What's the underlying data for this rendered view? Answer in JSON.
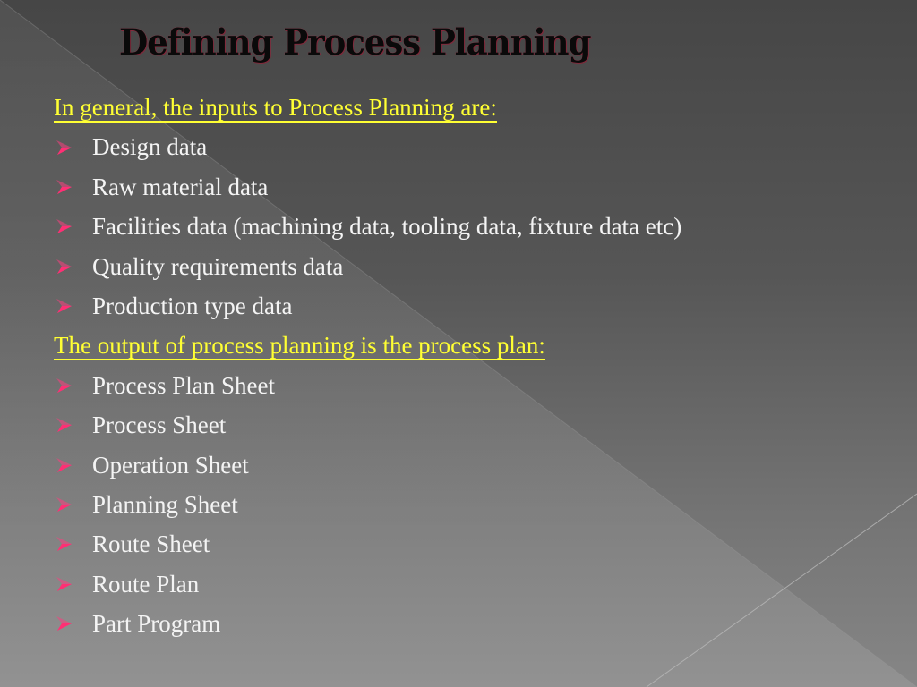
{
  "slide": {
    "title": "Defining Process Planning",
    "colors": {
      "title_text": "#0a0a0a",
      "title_outline": "#b0304a",
      "heading_text": "#ffff33",
      "bullet_text": "#f4f4f4",
      "bullet_icon": "#ff3d7f",
      "background_top": "#464646",
      "background_bottom": "#868686"
    },
    "inputs_section": {
      "heading": "In general, the inputs to Process Planning are:",
      "bullet_icon": "arrowhead-bullet-icon",
      "items": [
        "Design data",
        "Raw material data",
        "Facilities data (machining data, tooling data, fixture data etc)",
        "Quality requirements data",
        "Production type data"
      ]
    },
    "outputs_section": {
      "heading": "The output of process planning is the process plan:",
      "bullet_icon": "arrowhead-bullet-icon",
      "items": [
        "Process Plan Sheet",
        "Process Sheet",
        "Operation Sheet",
        "Planning Sheet",
        "Route Sheet",
        "Route Plan",
        "Part Program"
      ]
    }
  }
}
